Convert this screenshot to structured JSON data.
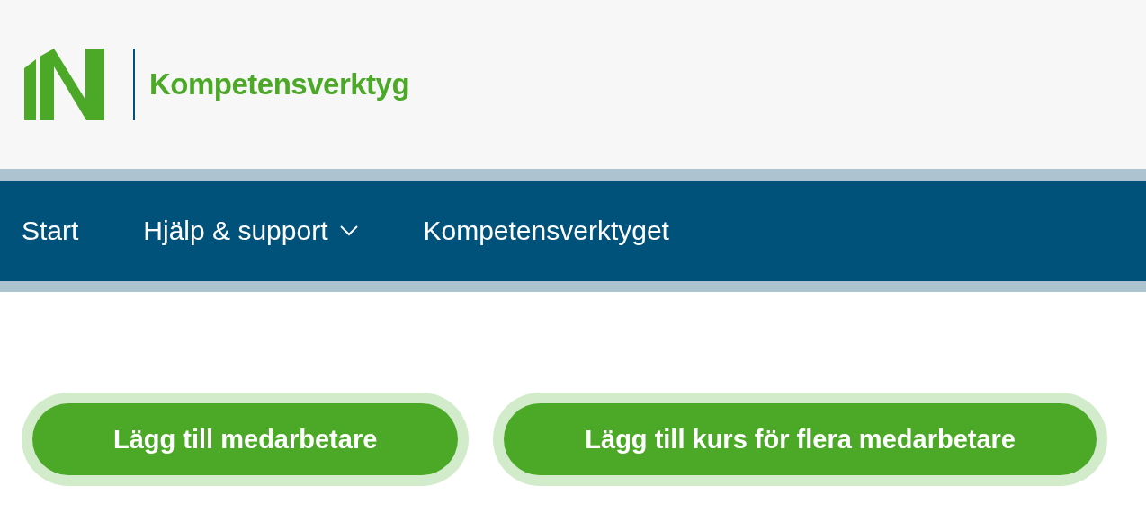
{
  "header": {
    "site_title": "Kompetensverktyg"
  },
  "nav": [
    {
      "label": "Start",
      "has_dropdown": false
    },
    {
      "label": "Hjälp & support",
      "has_dropdown": true
    },
    {
      "label": "Kompetensverktyget",
      "has_dropdown": false
    }
  ],
  "actions": [
    {
      "label": "Lägg till medarbetare"
    },
    {
      "label": "Lägg till kurs för flera medarbetare"
    }
  ]
}
